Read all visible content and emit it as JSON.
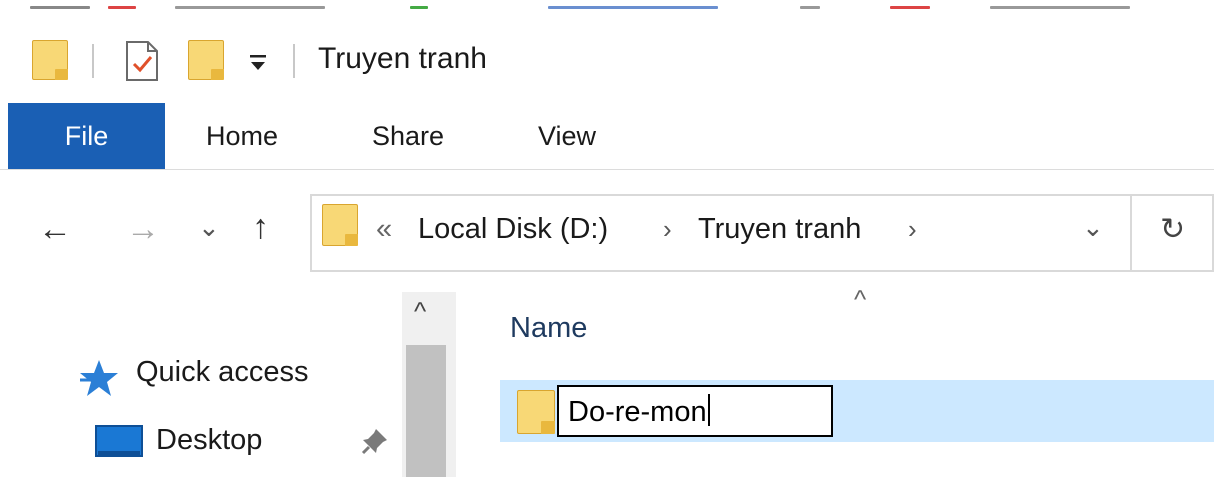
{
  "window": {
    "title": "Truyen tranh"
  },
  "quick_access_toolbar": {
    "icons": [
      "folder-icon",
      "properties-icon",
      "new-folder-icon",
      "customize-dropdown-icon"
    ]
  },
  "ribbon": {
    "tabs": [
      {
        "label": "File",
        "active": true
      },
      {
        "label": "Home"
      },
      {
        "label": "Share"
      },
      {
        "label": "View"
      }
    ],
    "colors": {
      "file_tab": "#1a5fb4"
    }
  },
  "address_bar": {
    "overflow_glyph": "«",
    "breadcrumb": [
      "Local Disk (D:)",
      "Truyen tranh"
    ],
    "separator": "›",
    "history_dropdown_glyph": "⌄",
    "refresh_glyph": "↻"
  },
  "nav_buttons": {
    "back": "←",
    "forward": "→",
    "recent": "⌄",
    "up": "↑"
  },
  "navigation_pane": {
    "items": [
      {
        "label": "Quick access",
        "icon": "star-icon"
      },
      {
        "label": "Desktop",
        "icon": "desktop-icon",
        "pinned": true
      }
    ],
    "scroll_up_glyph": "^"
  },
  "file_list": {
    "sort_glyph": "^",
    "columns": [
      "Name"
    ],
    "rows": [
      {
        "name": "Do-re-mon",
        "editing": true,
        "selected": true,
        "icon": "folder-icon"
      }
    ],
    "colors": {
      "selection": "#cce8ff"
    }
  }
}
